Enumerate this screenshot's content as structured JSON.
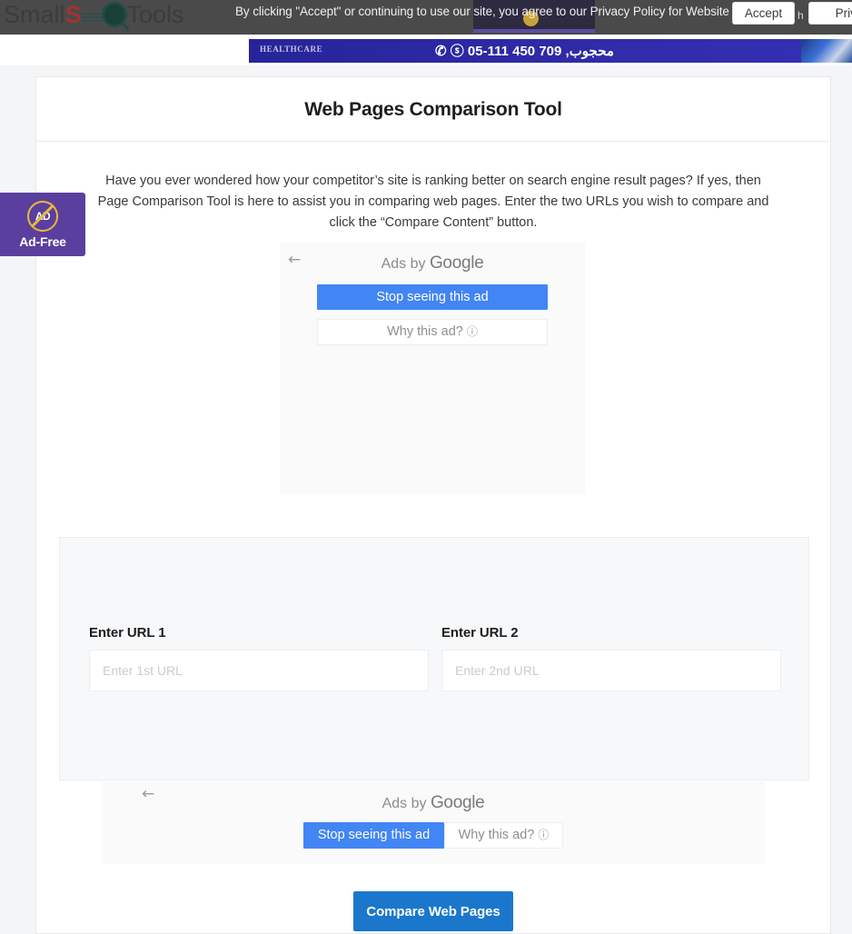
{
  "header": {
    "logo_text_parts": {
      "pre": "Small",
      "s": "S",
      "o": "O",
      "post": "Tools"
    },
    "logo_full": "SmallSEOTools",
    "cookie_message": "By clicking \"Accept\" or continuing to use our site, you agree to our Privacy Policy for Website",
    "accept_label": "Accept",
    "privacy_label": "Priva",
    "stray_char": "h"
  },
  "banner_ad": {
    "brand": "HEALTHCARE",
    "phone": "✆ ⓢ 05-111 450 709 ,ﻣﺤﺠﻮﺏ"
  },
  "adfree_badge": {
    "icon_text": "AD",
    "label": "Ad-Free"
  },
  "main": {
    "title": "Web Pages Comparison Tool",
    "intro": "Have you ever wondered how your competitor’s site is ranking better on search engine result pages? If yes, then Page Comparison Tool is here to assist you in comparing web pages. Enter the two URLs you wish to compare and click the “Compare Content” button."
  },
  "ad_block_1": {
    "back_arrow": "←",
    "ads_by": "Ads by",
    "google": "Google",
    "stop_label": "Stop seeing this ad",
    "why_label": "Why this ad?",
    "info_glyph": "ⓘ"
  },
  "ad_block_2": {
    "back_arrow": "←",
    "ads_by": "Ads by",
    "google": "Google",
    "stop_label": "Stop seeing this ad",
    "why_label": "Why this ad?",
    "info_glyph": "ⓘ"
  },
  "form": {
    "url1": {
      "label": "Enter URL 1",
      "placeholder": "Enter 1st URL",
      "value": ""
    },
    "url2": {
      "label": "Enter URL 2",
      "placeholder": "Enter 2nd URL",
      "value": ""
    }
  },
  "actions": {
    "compare_label": "Compare Web Pages"
  },
  "colors": {
    "header_bg": "#4a4a4a",
    "cookie_patch": "#2e2a40",
    "google_blue": "#4285f4",
    "compare_blue": "#1b77cc",
    "adfree_purple": "#5b3f9e",
    "adfree_gold": "#e9b93c",
    "banner_blue": "#2c2a9e",
    "panel_bg": "#f7f8fa",
    "page_bg": "#f4f5f7"
  }
}
